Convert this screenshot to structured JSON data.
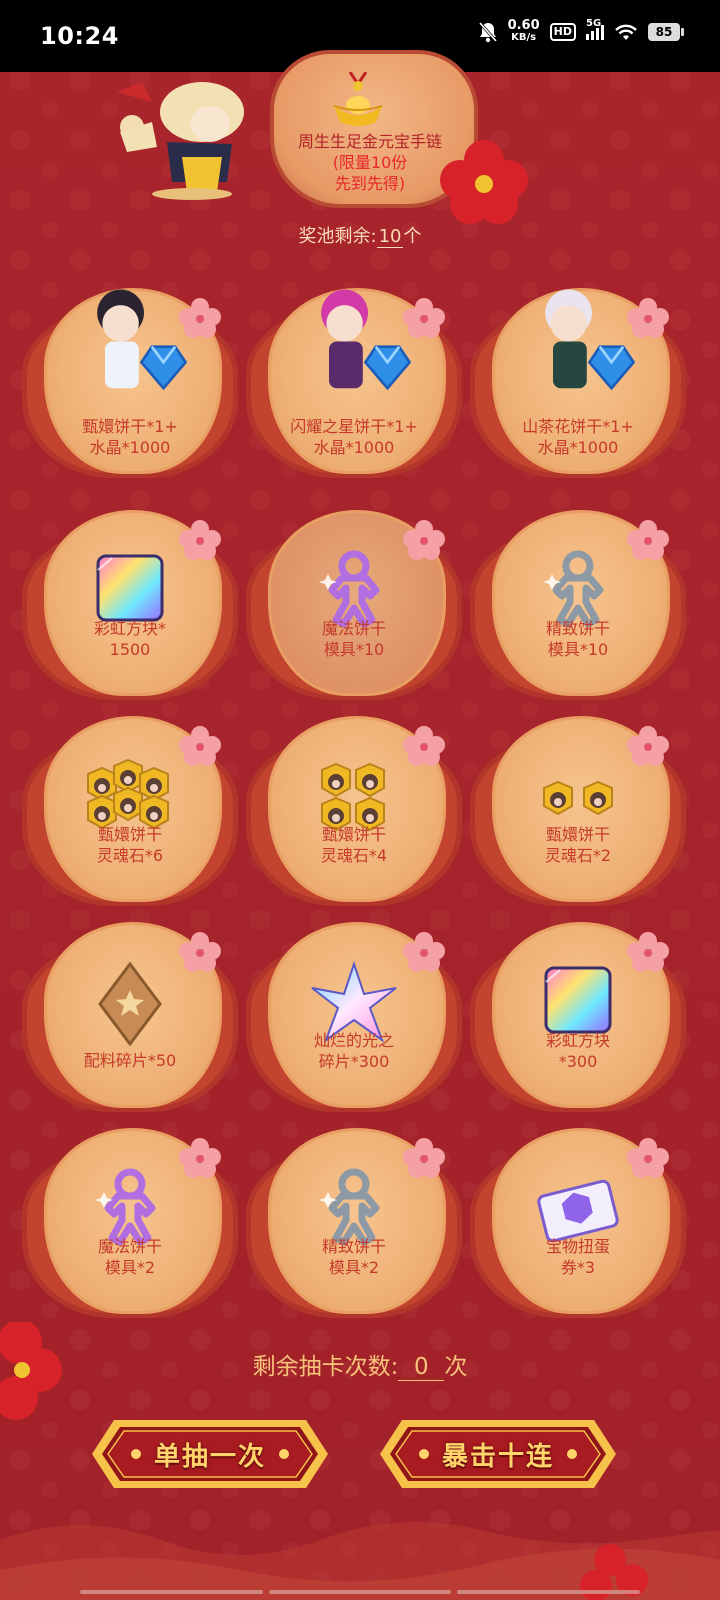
{
  "status_bar": {
    "time": "10:24",
    "speed_value": "0.60",
    "speed_unit": "KB/s",
    "hd": "HD",
    "network": "5G",
    "battery": "85"
  },
  "top_prize": {
    "name": "周生生足金元宝手链",
    "limit": "(限量10份",
    "first_come": "先到先得)"
  },
  "pool": {
    "prefix": "奖池剩余:",
    "count": "10",
    "unit": "个"
  },
  "prizes": [
    {
      "line1": "甄嬛饼干*1+",
      "line2": "水晶*1000",
      "icon": "cookie-character-crystal"
    },
    {
      "line1": "闪耀之星饼干*1+",
      "line2": "水晶*1000",
      "icon": "cookie-character-crystal"
    },
    {
      "line1": "山茶花饼干*1+",
      "line2": "水晶*1000",
      "icon": "cookie-character-crystal"
    },
    {
      "line1": "彩虹方块*",
      "line2": "1500",
      "icon": "rainbow-cube"
    },
    {
      "line1": "魔法饼干",
      "line2": "模具*10",
      "icon": "magic-cookie-mold"
    },
    {
      "line1": "精致饼干",
      "line2": "模具*10",
      "icon": "fine-cookie-mold"
    },
    {
      "line1": "甄嬛饼干",
      "line2": "灵魂石*6",
      "icon": "soulstone"
    },
    {
      "line1": "甄嬛饼干",
      "line2": "灵魂石*4",
      "icon": "soulstone"
    },
    {
      "line1": "甄嬛饼干",
      "line2": "灵魂石*2",
      "icon": "soulstone"
    },
    {
      "line1": "配料碎片*50",
      "line2": "",
      "icon": "topping-shard"
    },
    {
      "line1": "灿烂的光之",
      "line2": "碎片*300",
      "icon": "star-shard"
    },
    {
      "line1": "彩虹方块",
      "line2": "*300",
      "icon": "rainbow-cube"
    },
    {
      "line1": "魔法饼干",
      "line2": "模具*2",
      "icon": "magic-cookie-mold"
    },
    {
      "line1": "精致饼干",
      "line2": "模具*2",
      "icon": "fine-cookie-mold"
    },
    {
      "line1": "宝物扭蛋",
      "line2": "券*3",
      "icon": "gacha-ticket"
    }
  ],
  "remaining": {
    "prefix": "剩余抽卡次数:",
    "count": "0",
    "unit": "次"
  },
  "buttons": {
    "single": "单抽一次",
    "ten": "暴击十连"
  },
  "colors": {
    "background": "#a5232a",
    "card_inner": "#efb176",
    "label_text": "#c53a2b",
    "gold_text": "#ffd46a"
  }
}
